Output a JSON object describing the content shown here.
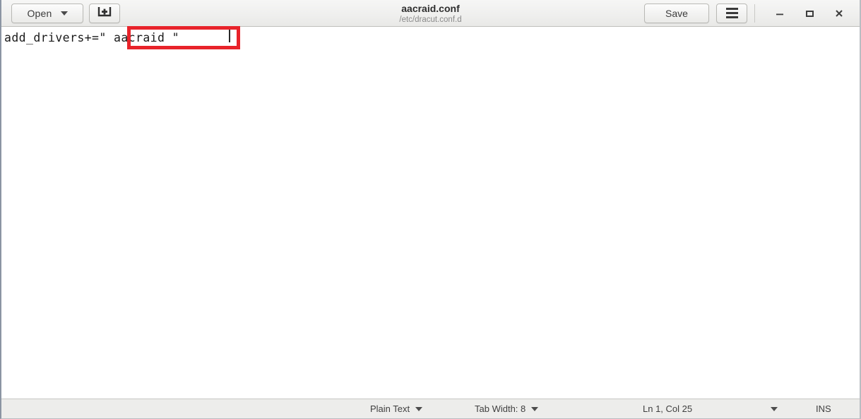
{
  "window": {
    "title": "aacraid.conf",
    "subtitle": "/etc/dracut.conf.d"
  },
  "headerbar": {
    "open_label": "Open",
    "open_caret_icon": "chevron-down-icon",
    "new_document_icon": "new-document-icon",
    "save_label": "Save",
    "menu_icon": "hamburger-menu-icon",
    "minimize_icon": "minimize-icon",
    "maximize_icon": "maximize-icon",
    "close_icon": "close-icon"
  },
  "editor": {
    "line_1": "add_drivers+=\" aacraid \"",
    "annotation": {
      "shape": "rectangle",
      "color": "#e8232a",
      "highlights": "\" aacraid \""
    }
  },
  "statusbar": {
    "language": "Plain Text",
    "tab_width": "Tab Width: 8",
    "position": "Ln 1, Col 25",
    "insert_mode": "INS",
    "caret_icon": "chevron-down-icon"
  },
  "colors": {
    "annotation_red": "#e8232a",
    "header_bg": "#f0f0ef",
    "statusbar_bg": "#ededeb",
    "editor_bg": "#ffffff"
  }
}
